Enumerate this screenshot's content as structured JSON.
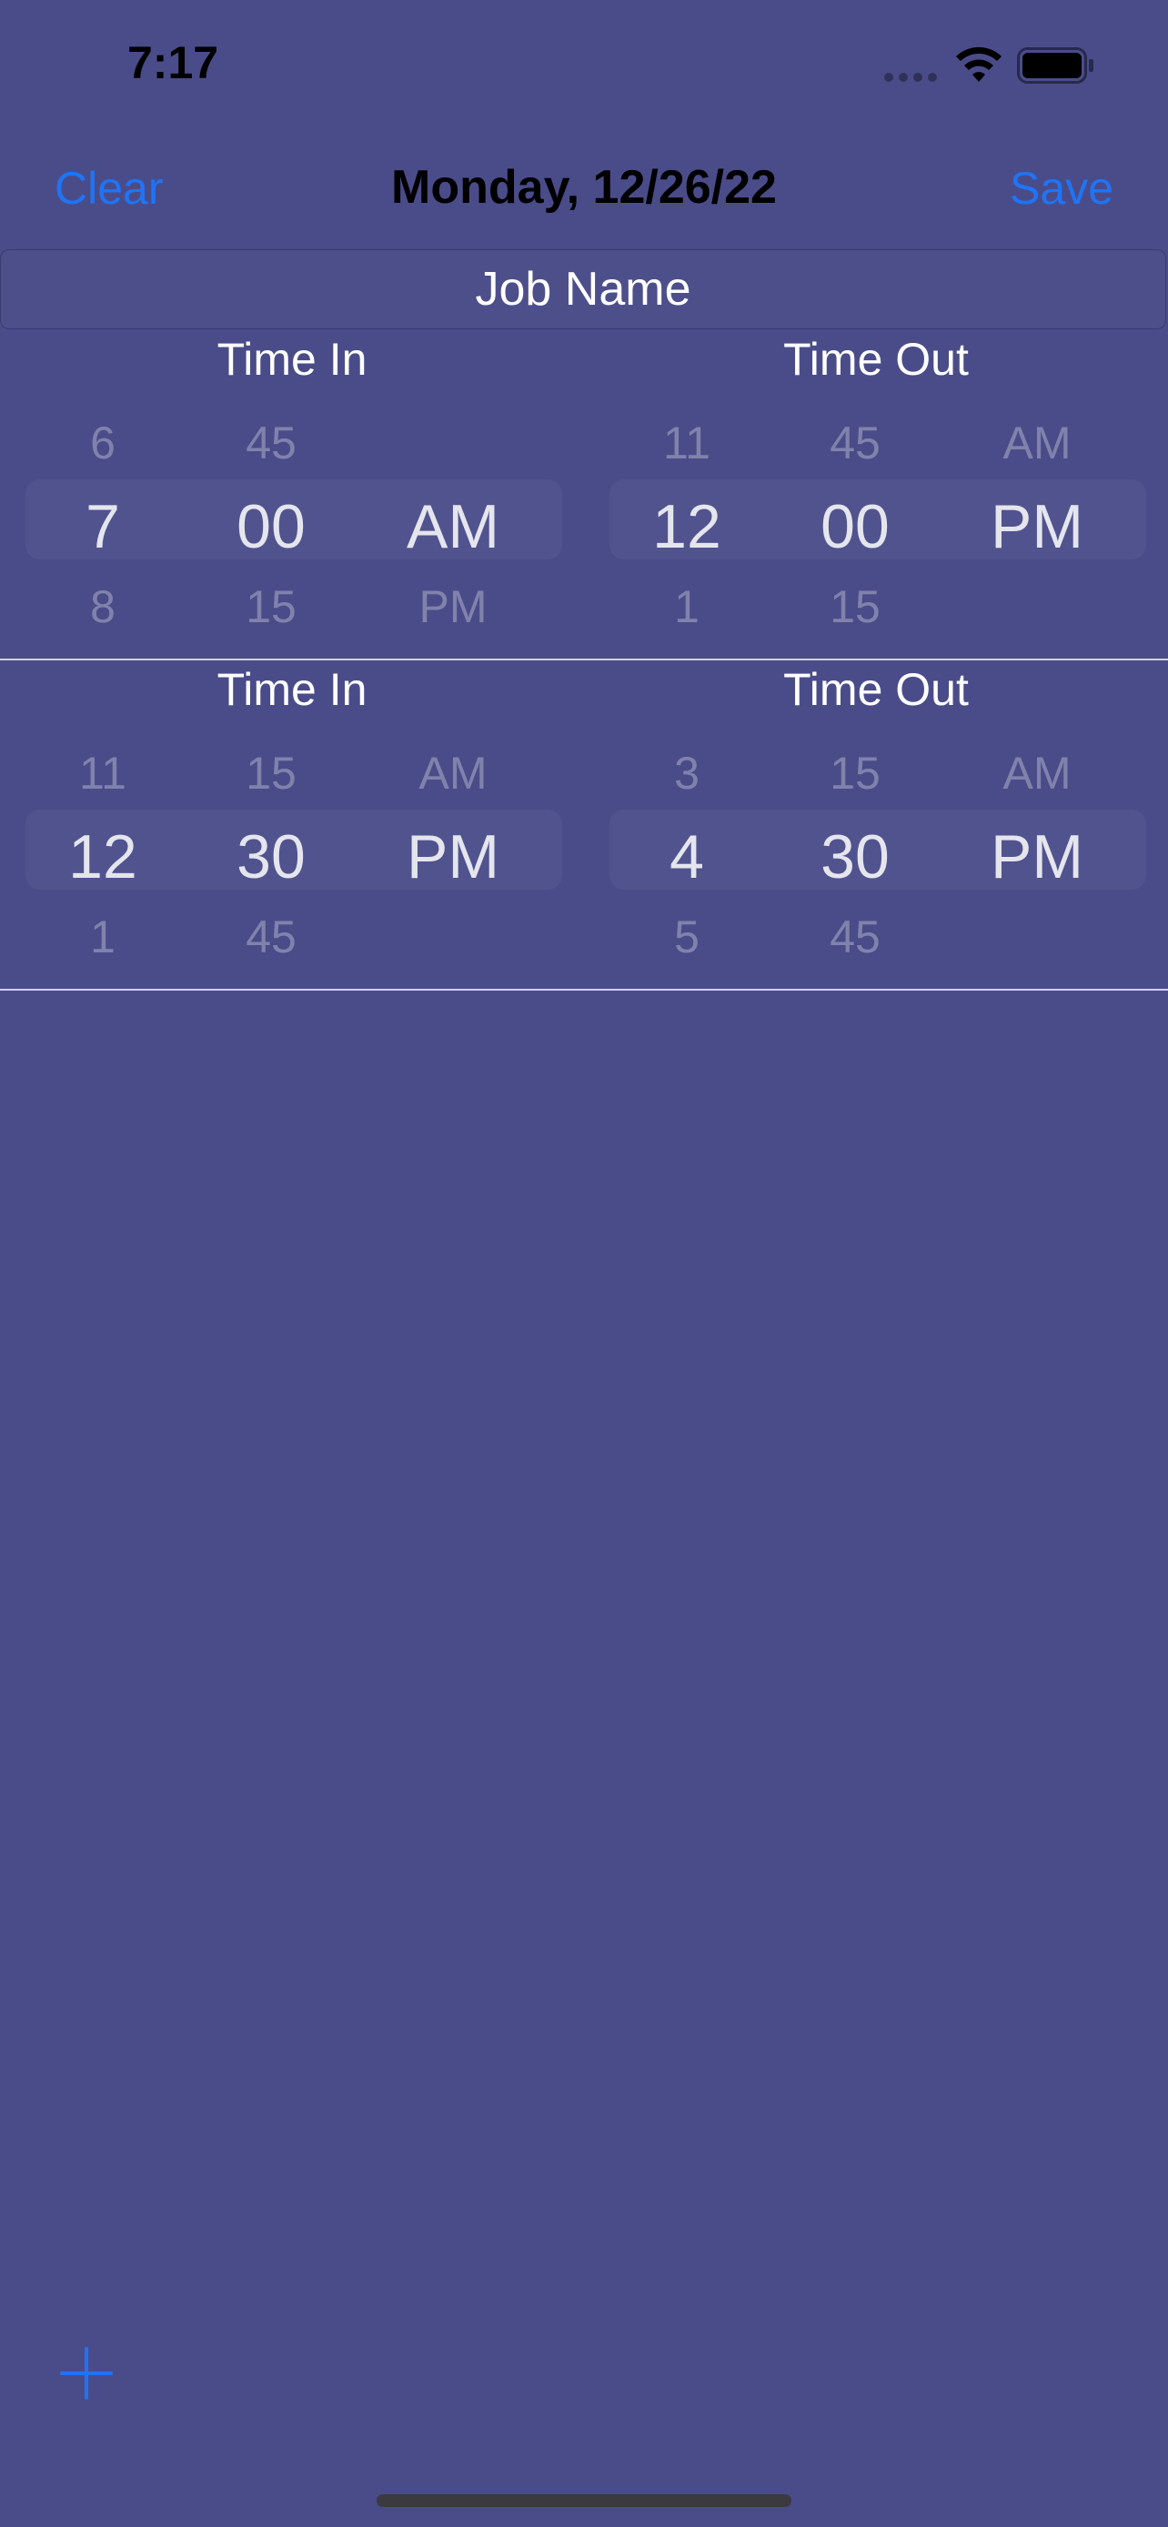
{
  "status_bar": {
    "time": "7:17",
    "icons": [
      "cellular-signal-icon",
      "wifi-icon",
      "battery-icon"
    ]
  },
  "nav": {
    "clear_label": "Clear",
    "title": "Monday, 12/26/22",
    "save_label": "Save"
  },
  "job_name": {
    "placeholder": "Job Name",
    "value": ""
  },
  "entries": [
    {
      "time_in": {
        "label": "Time In",
        "hour": {
          "prev": "6",
          "selected": "7",
          "next": "8"
        },
        "minute": {
          "prev": "45",
          "selected": "00",
          "next": "15"
        },
        "period": {
          "prev": "",
          "selected": "AM",
          "next": "PM"
        }
      },
      "time_out": {
        "label": "Time Out",
        "hour": {
          "prev": "11",
          "selected": "12",
          "next": "1"
        },
        "minute": {
          "prev": "45",
          "selected": "00",
          "next": "15"
        },
        "period": {
          "prev": "AM",
          "selected": "PM",
          "next": ""
        }
      }
    },
    {
      "time_in": {
        "label": "Time In",
        "hour": {
          "prev": "11",
          "selected": "12",
          "next": "1"
        },
        "minute": {
          "prev": "15",
          "selected": "30",
          "next": "45"
        },
        "period": {
          "prev": "AM",
          "selected": "PM",
          "next": ""
        }
      },
      "time_out": {
        "label": "Time Out",
        "hour": {
          "prev": "3",
          "selected": "4",
          "next": "5"
        },
        "minute": {
          "prev": "15",
          "selected": "30",
          "next": "45"
        },
        "period": {
          "prev": "AM",
          "selected": "PM",
          "next": ""
        }
      }
    }
  ],
  "add_button": {
    "icon": "plus-icon"
  },
  "colors": {
    "background": "#4a4c89",
    "accent": "#1f74f6",
    "title": "#000000"
  }
}
